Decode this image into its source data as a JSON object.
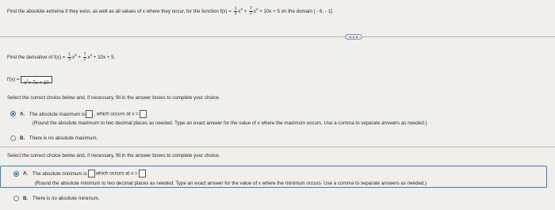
{
  "question": {
    "prefix": "Find the absolute extrema if they exist, as well as all values of x where they occur, for the function f(x) =",
    "f_coef1_num": "1",
    "f_coef1_den": "3",
    "f_x3": "x",
    "f_exp3": "3",
    "f_plus1": "+",
    "f_coef2_num": "7",
    "f_coef2_den": "2",
    "f_x2": "x",
    "f_exp2": "2",
    "f_rest": "+ 10x + 5 on the domain",
    "domain": "[ - 6, - 1]."
  },
  "derivative": {
    "prompt": "Find the derivative of f(x) =",
    "f_rest": "+ 10x + 5.",
    "label": "f'(x) =",
    "answer_x": "x",
    "answer_exp": "2",
    "answer_rest": "+ 7x + 10"
  },
  "part_max": {
    "instruction": "Select the correct choice below and, if necessary, fill in the answer boxes to complete your choice.",
    "option_a_letter": "A.",
    "option_a_text1": "The absolute maximum is",
    "option_a_text2": ", which occurs at x =",
    "option_a_hint": "(Round the absolute maximum to two decimal places as needed. Type an exact answer for the value of x where the maximum occurs. Use a comma to separate answers as needed.)",
    "option_b_letter": "B.",
    "option_b_text": "There is no absolute maximum.",
    "selected": "A"
  },
  "part_min": {
    "instruction": "Select the correct choice below and, if necessary, fill in the answer boxes to complete your choice.",
    "option_a_letter": "A.",
    "option_a_text1": "The absolute minimum is",
    "option_a_text2": "which occurs at x =",
    "option_a_hint": "(Round the absolute minimum to two decimal places as needed. Type an exact answer for the value of x where the minimum occurs. Use a comma to separate answers as needed.)",
    "option_b_letter": "B.",
    "option_b_text": "There is no absolute minimum.",
    "selected": "A"
  },
  "more_button_icon": "ellipsis-icon"
}
